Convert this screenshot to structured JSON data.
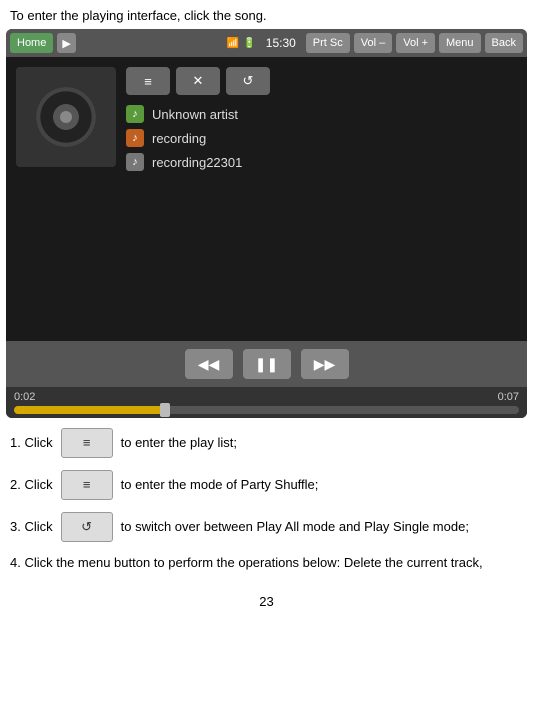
{
  "intro": {
    "text": "To enter the playing interface, click the song."
  },
  "topbar": {
    "home_label": "Home",
    "play_icon": "▶",
    "time": "15:30",
    "prtsc_label": "Prt Sc",
    "voldown_label": "Vol –",
    "volup_label": "Vol +",
    "menu_label": "Menu",
    "back_label": "Back"
  },
  "player": {
    "album_art_alt": "album art",
    "ctrl_btn1": "≡",
    "ctrl_btn2": "✕",
    "ctrl_btn3": "↺",
    "artist": "Unknown artist",
    "track1": "recording",
    "track2": "recording22301",
    "progress_start": "0:02",
    "progress_end": "0:07",
    "btn_prev": "◀◀",
    "btn_pause": "❚❚",
    "btn_next": "▶▶"
  },
  "instructions": {
    "item1_label": "1. Click",
    "item1_text": "to enter the play list;",
    "item2_label": "2. Click",
    "item2_text": "to enter the mode of Party Shuffle;",
    "item3_label": "3. Click",
    "item3_text": "to switch over between Play All mode and Play Single mode;",
    "item4_text": "4. Click the menu button to perform the operations below: Delete the current track,",
    "btn1_icon": "≡",
    "btn2_icon": "≡",
    "btn3_icon": "↺",
    "page_number": "23"
  }
}
